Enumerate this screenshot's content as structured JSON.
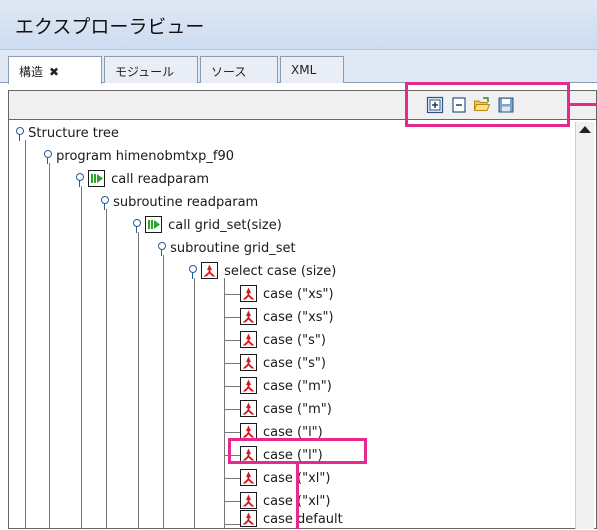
{
  "panel": {
    "title": "エクスプローラビュー"
  },
  "tabs": [
    {
      "label": "構造",
      "close": "✖"
    },
    {
      "label": "モジュール"
    },
    {
      "label": "ソース"
    },
    {
      "label": "XML"
    }
  ],
  "toolbar": {
    "icons": [
      "expand-all-icon",
      "collapse-all-icon",
      "open-folder-icon",
      "save-icon"
    ]
  },
  "tree": {
    "root": "Structure tree",
    "program": "program himenobmtxp_f90",
    "call_readparam": "call readparam",
    "sub_readparam": "subroutine readparam",
    "call_grid_set": "call grid_set(size)",
    "sub_grid_set": "subroutine grid_set",
    "select_case": "select case (size)",
    "cases": [
      "case (\"xs\")",
      "case (\"xs\")",
      "case (\"s\")",
      "case (\"s\")",
      "case (\"m\")",
      "case (\"m\")",
      "case (\"l\")",
      "case (\"l\")",
      "case (\"xl\")",
      "case (\"xl\")",
      "case default"
    ]
  },
  "colors": {
    "highlight": "#e6298f",
    "call_icon_green": "#2aa52a",
    "case_icon_red": "#d81a1a"
  }
}
